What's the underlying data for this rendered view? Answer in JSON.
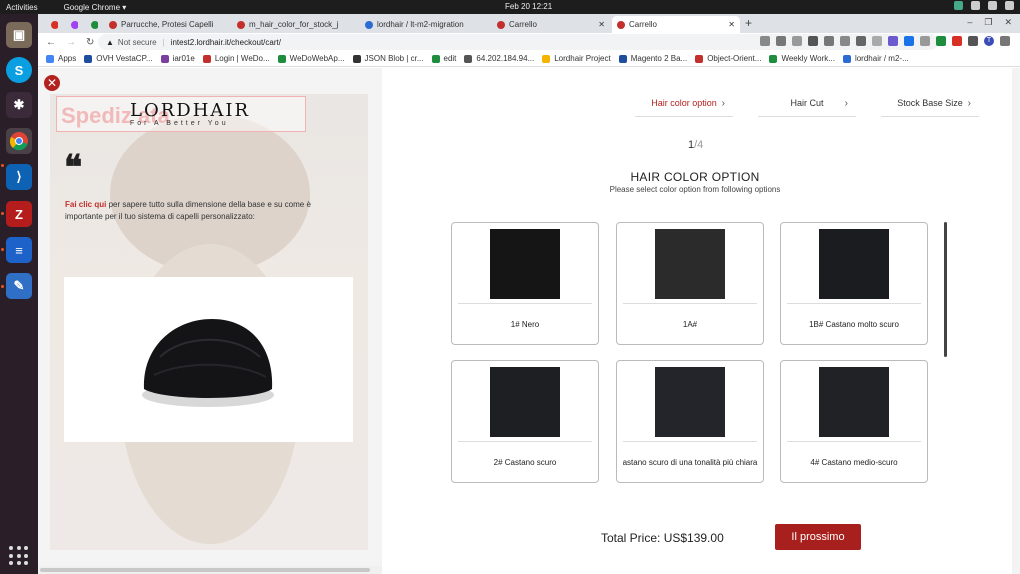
{
  "os": {
    "activities": "Activities",
    "app_name": "Google Chrome ▾",
    "clock": "Feb 20  12:21"
  },
  "browser": {
    "tabs": [
      {
        "label": "Parrucche, Protesi Capelli",
        "color": "#c3302b"
      },
      {
        "label": "m_hair_color_for_stock_j",
        "color": "#c3302b"
      },
      {
        "label": "lordhair / lt-m2-migration",
        "color": "#2b6cd4"
      },
      {
        "label": "Carrello",
        "color": "#c3302b"
      },
      {
        "label": "Carrello",
        "color": "#c3302b"
      }
    ],
    "not_secure": "Not secure",
    "url": "intest2.lordhair.it/checkout/cart/",
    "bookmarks": [
      {
        "label": "Apps",
        "color": "#4285f4"
      },
      {
        "label": "OVH VestaCP...",
        "color": "#1f4e9c"
      },
      {
        "label": "iar01e",
        "color": "#7b3fa0"
      },
      {
        "label": "Login | WeDo...",
        "color": "#c3302b"
      },
      {
        "label": "WeDoWebAp...",
        "color": "#1e8e3e"
      },
      {
        "label": "JSON Blob | cr...",
        "color": "#333333"
      },
      {
        "label": "edit",
        "color": "#1e8e3e"
      },
      {
        "label": "64.202.184.94...",
        "color": "#555555"
      },
      {
        "label": "Lordhair Project",
        "color": "#f4b400"
      },
      {
        "label": "Magento 2 Ba...",
        "color": "#1f4e9c"
      },
      {
        "label": "Object-Orient...",
        "color": "#c3302b"
      },
      {
        "label": "Weekly Work...",
        "color": "#1e8e3e"
      },
      {
        "label": "lordhair / m2-...",
        "color": "#2b6cd4"
      }
    ]
  },
  "left_panel": {
    "banner_faded": "Spediz                     ata",
    "logo": "LORDHAIR",
    "logo_tagline": "For A Better You",
    "quote_mark": "❝",
    "info_link": "Fai clic qui",
    "info_text": " per sapere tutto sulla dimensione della base e su come è importante per il tuo sistema di capelli personalizzato:"
  },
  "steps": [
    {
      "label": "Hair color option",
      "active": true
    },
    {
      "label": "Hair Cut",
      "active": false
    },
    {
      "label": "Stock Base Size",
      "active": false
    }
  ],
  "counter": {
    "current": "1",
    "rest": "/4"
  },
  "heading": "HAIR COLOR OPTION",
  "subheading": "Please select color option from following options",
  "options": [
    {
      "label": "1# Nero",
      "color": "#151515"
    },
    {
      "label": "1A#",
      "color": "#2b2b2b"
    },
    {
      "label": "1B# Castano molto scuro",
      "color": "#1b1c20"
    },
    {
      "label": "2# Castano scuro",
      "color": "#1e1f23"
    },
    {
      "label": "astano scuro di una tonalità più chiara",
      "color": "#23252a"
    },
    {
      "label": "4# Castano medio-scuro",
      "color": "#202226"
    }
  ],
  "total": "Total Price: US$139.00",
  "next_button": "Il prossimo",
  "accent": "#a8201d"
}
